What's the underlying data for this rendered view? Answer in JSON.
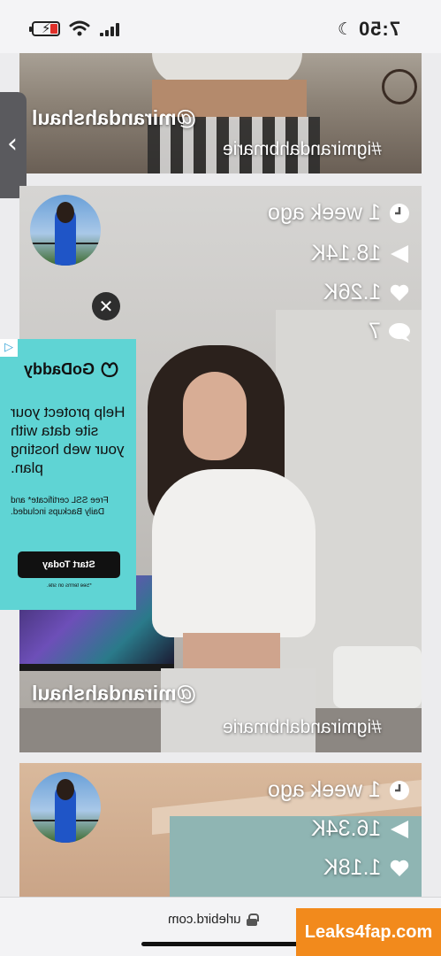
{
  "status_bar": {
    "time": "7:50",
    "battery_color": "#e0302a"
  },
  "browser": {
    "url": "urlebird.com"
  },
  "colors": {
    "ad_background": "#5fd4d4",
    "watermark_background": "#f28a1c",
    "side_tab": "#5a5a5e"
  },
  "posts": [
    {
      "handle": "@mirandahshaul",
      "hashtag": "#igmirandahbmarie"
    },
    {
      "handle": "@mirandahshaul",
      "hashtag": "#igmirandahbmarie",
      "stats": {
        "posted": "1 week ago",
        "views": "18.14K",
        "likes": "1.26K",
        "comments": "7"
      }
    },
    {
      "stats": {
        "posted": "1 week ago",
        "views": "16.34K",
        "likes": "1.18K"
      }
    }
  ],
  "ad": {
    "brand": "GoDaddy",
    "headline": "Help protect your site data with your web hosting plan.",
    "body": "Free SSL certificate* and Daily Backups included.",
    "cta": "Start Today",
    "terms": "*See terms on site."
  },
  "icons": {
    "close": "close-icon",
    "side_tab": "chevron-left-icon",
    "clock": "clock-icon",
    "play": "play-icon",
    "heart": "heart-icon",
    "comment": "comment-icon",
    "ad_choices": "ad-choices-icon",
    "lock": "lock-icon"
  },
  "watermark": "Leaks4fap.com"
}
